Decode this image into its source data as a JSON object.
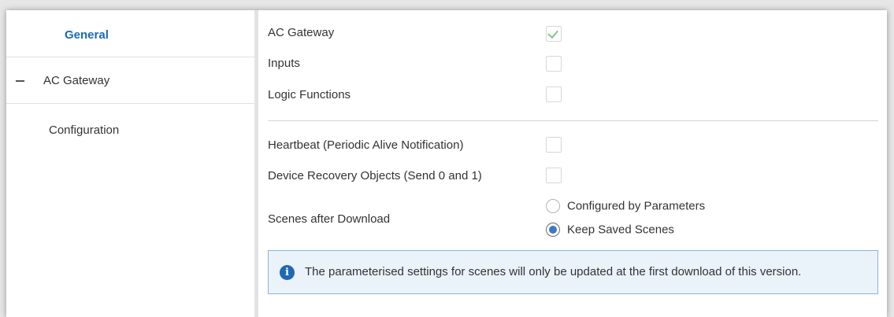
{
  "sidebar": {
    "items": [
      {
        "label": "General",
        "active": true
      },
      {
        "label": "AC Gateway",
        "expanded": true
      },
      {
        "label": "Configuration"
      }
    ]
  },
  "general": {
    "ac_gateway_label": "AC Gateway",
    "ac_gateway_checked": true,
    "inputs_label": "Inputs",
    "inputs_checked": false,
    "logic_label": "Logic Functions",
    "logic_checked": false,
    "heartbeat_label": "Heartbeat (Periodic Alive Notification)",
    "heartbeat_checked": false,
    "recovery_label": "Device Recovery Objects (Send 0 and 1)",
    "recovery_checked": false,
    "scenes_label": "Scenes after Download",
    "scenes_options": [
      "Configured by Parameters",
      "Keep Saved Scenes"
    ],
    "scenes_selected": "Keep Saved Scenes"
  },
  "info": {
    "icon": "info-icon",
    "text": "The parameterised settings for scenes will only be updated at the first download of this version."
  },
  "colors": {
    "accent": "#1b69b6",
    "check": "#7ec87e",
    "info_bg": "#eaf2fa",
    "info_border": "#8fb2d8"
  }
}
